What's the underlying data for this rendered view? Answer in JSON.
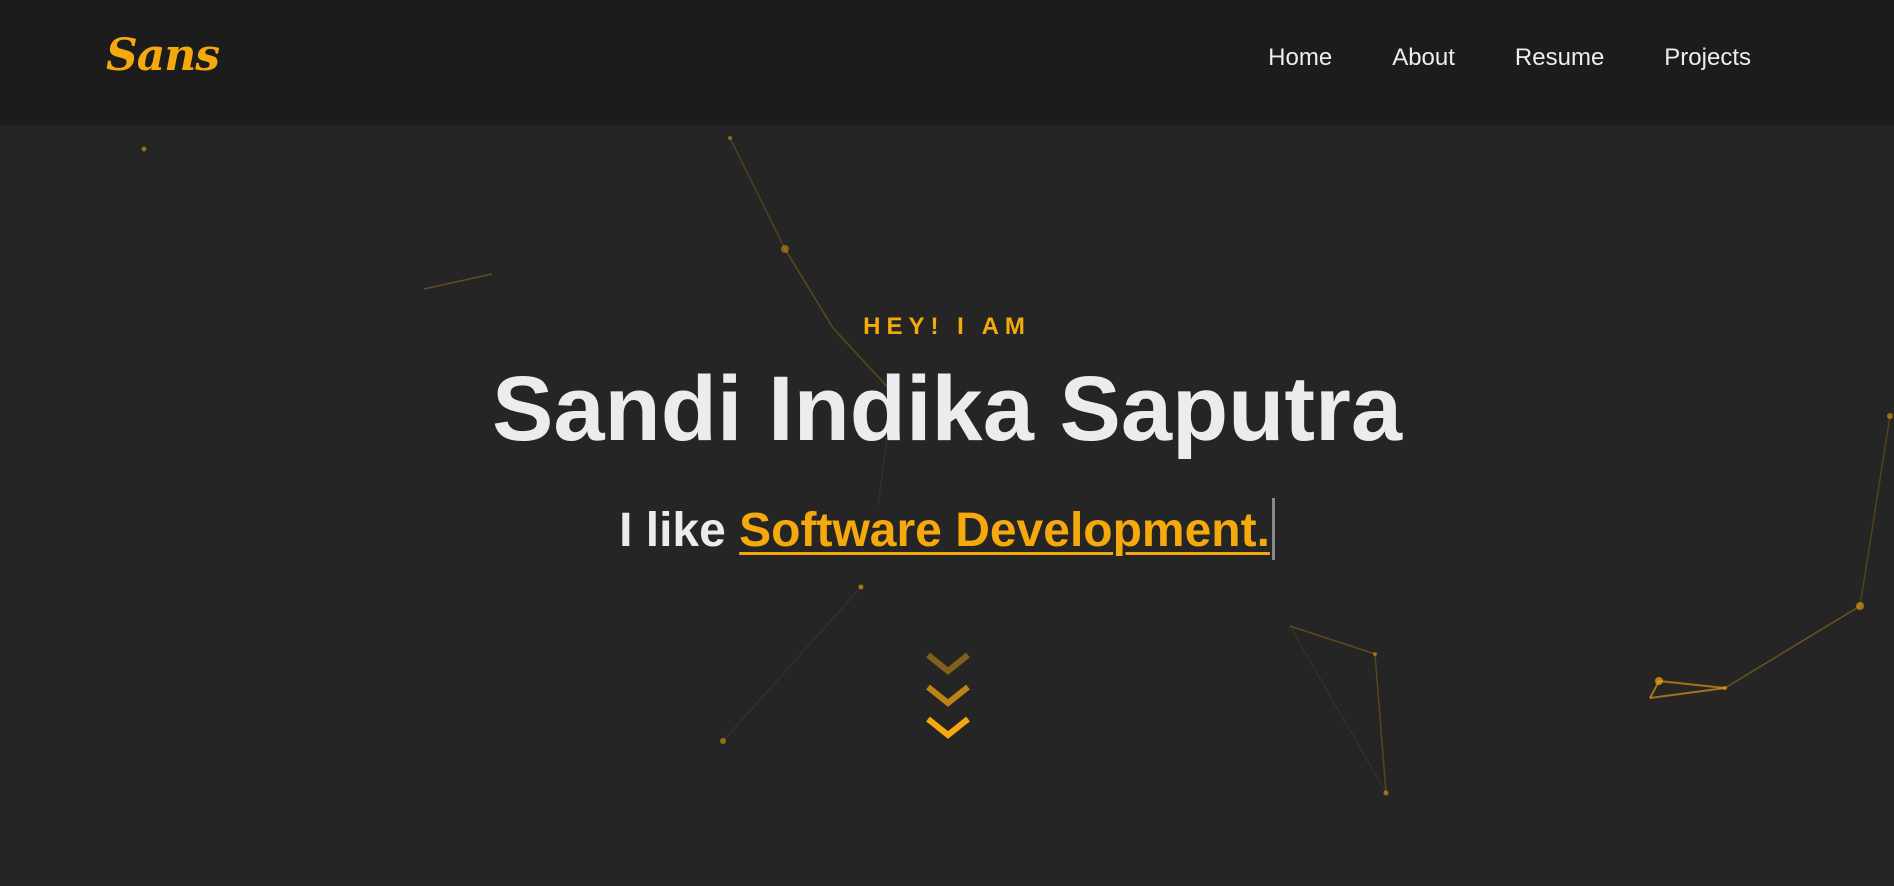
{
  "brand": {
    "logo_text": "Sans"
  },
  "nav": {
    "items": [
      {
        "label": "Home"
      },
      {
        "label": "About"
      },
      {
        "label": "Resume"
      },
      {
        "label": "Projects"
      }
    ]
  },
  "hero": {
    "eyebrow": "HEY! I AM",
    "name": "Sandi Indika Saputra",
    "tagline_prefix": "I like ",
    "tagline_highlight": "Software Development."
  },
  "colors": {
    "accent": "#f6a90c",
    "navbar_bg": "#1c1c1c",
    "page_bg": "#252525",
    "text": "#ececec"
  },
  "icons": {
    "scroll": "chevron-down-icon"
  }
}
